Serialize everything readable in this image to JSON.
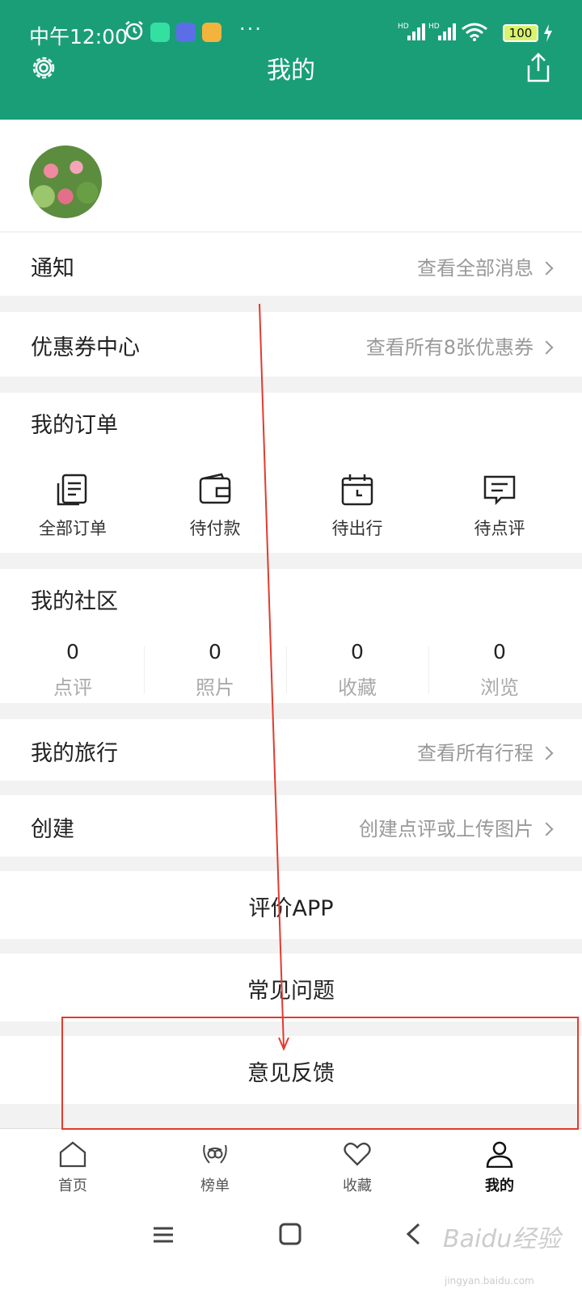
{
  "status_bar": {
    "time": "中午12:00",
    "dots": "···",
    "battery": "100"
  },
  "header": {
    "title": "我的"
  },
  "notification": {
    "label": "通知",
    "link": "查看全部消息"
  },
  "coupon": {
    "label": "优惠券中心",
    "link": "查看所有8张优惠券"
  },
  "orders": {
    "title": "我的订单",
    "items": [
      {
        "label": "全部订单",
        "icon": "order-list-icon"
      },
      {
        "label": "待付款",
        "icon": "wallet-icon"
      },
      {
        "label": "待出行",
        "icon": "calendar-icon"
      },
      {
        "label": "待点评",
        "icon": "comment-icon"
      }
    ]
  },
  "community": {
    "title": "我的社区",
    "stats": [
      {
        "value": "0",
        "label": "点评"
      },
      {
        "value": "0",
        "label": "照片"
      },
      {
        "value": "0",
        "label": "收藏"
      },
      {
        "value": "0",
        "label": "浏览"
      }
    ]
  },
  "trips": {
    "label": "我的旅行",
    "link": "查看所有行程"
  },
  "create": {
    "label": "创建",
    "link": "创建点评或上传图片"
  },
  "actions": {
    "rate_app": "评价APP",
    "faq": "常见问题",
    "feedback": "意见反馈"
  },
  "bottom_nav": [
    {
      "label": "首页",
      "icon": "home-icon"
    },
    {
      "label": "榜单",
      "icon": "owl-laurel-icon"
    },
    {
      "label": "收藏",
      "icon": "heart-icon"
    },
    {
      "label": "我的",
      "icon": "person-icon",
      "active": true
    }
  ],
  "watermark": {
    "brand": "Baidu经验",
    "url": "jingyan.baidu.com"
  },
  "colors": {
    "brand": "#1a9e78",
    "annotation": "#e23b2e"
  }
}
